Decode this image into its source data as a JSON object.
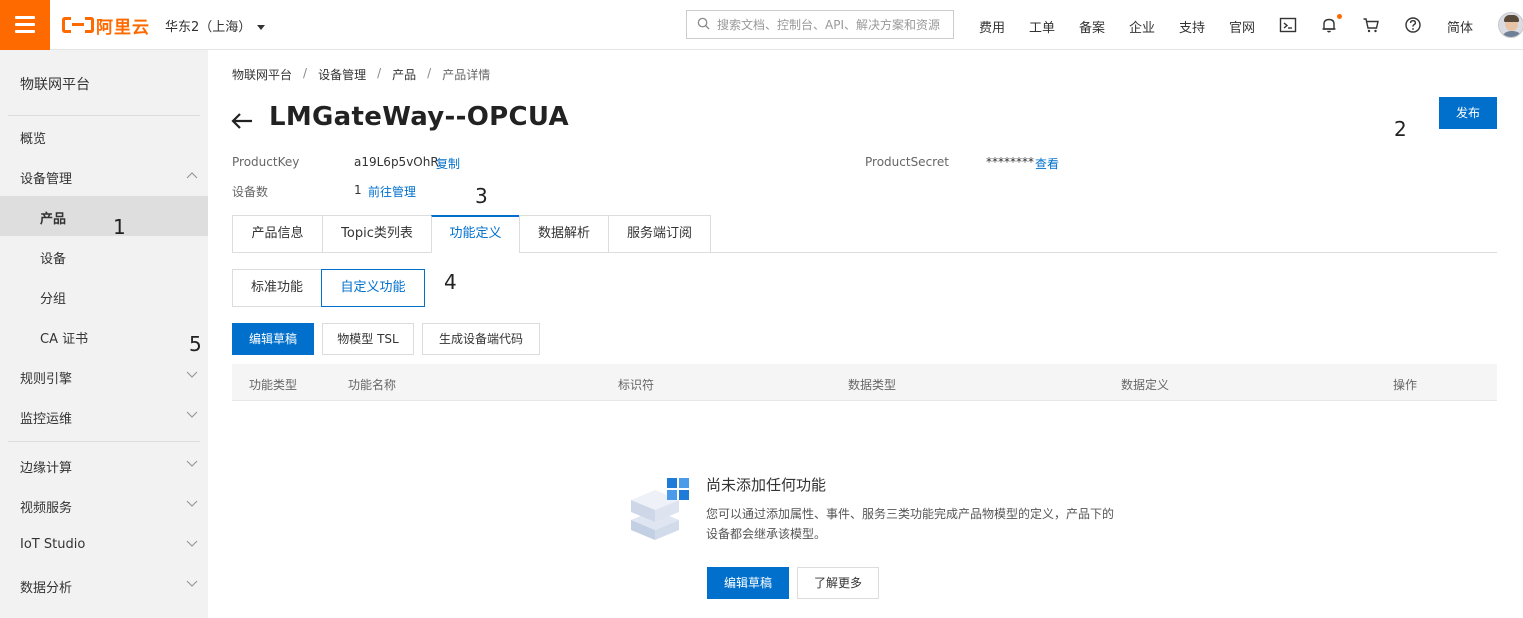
{
  "topbar": {
    "brand": "阿里云",
    "region": "华东2（上海）",
    "search_placeholder": "搜索文档、控制台、API、解决方案和资源",
    "nav": [
      "费用",
      "工单",
      "备案",
      "企业",
      "支持",
      "官网"
    ],
    "lang": "简体",
    "accent_color": "#ff6a00"
  },
  "sidebar": {
    "title": "物联网平台",
    "items": [
      {
        "label": "概览"
      },
      {
        "label": "设备管理"
      },
      {
        "label": "产品"
      },
      {
        "label": "设备"
      },
      {
        "label": "分组"
      },
      {
        "label": "CA 证书"
      },
      {
        "label": "规则引擎"
      },
      {
        "label": "监控运维"
      },
      {
        "label": "边缘计算"
      },
      {
        "label": "视频服务"
      },
      {
        "label": "IoT Studio"
      },
      {
        "label": "数据分析"
      }
    ]
  },
  "annotations": [
    "1",
    "2",
    "3",
    "4",
    "5"
  ],
  "breadcrumb": [
    "物联网平台",
    "设备管理",
    "产品",
    "产品详情"
  ],
  "page": {
    "title": "LMGateWay--OPCUA",
    "publish_button": "发布",
    "product_key_label": "ProductKey",
    "product_key_value": "a19L6p5vOhR",
    "copy_link": "复制",
    "product_secret_label": "ProductSecret",
    "product_secret_value": "********",
    "view_link": "查看",
    "device_count_label": "设备数",
    "device_count_value": "1",
    "manage_link": "前往管理"
  },
  "tabs": [
    "产品信息",
    "Topic类列表",
    "功能定义",
    "数据解析",
    "服务端订阅"
  ],
  "active_tab": "功能定义",
  "segments": [
    "标准功能",
    "自定义功能"
  ],
  "active_segment": "自定义功能",
  "toolbar": {
    "edit_draft": "编辑草稿",
    "tsl": "物模型 TSL",
    "gen_code": "生成设备端代码"
  },
  "table": {
    "columns": [
      "功能类型",
      "功能名称",
      "标识符",
      "数据类型",
      "数据定义",
      "操作"
    ]
  },
  "empty": {
    "title": "尚未添加任何功能",
    "desc": "您可以通过添加属性、事件、服务三类功能完成产品物模型的定义，产品下的设备都会继承该模型。",
    "edit_button": "编辑草稿",
    "learn_more": "了解更多"
  },
  "colors": {
    "primary": "#0070cc",
    "accent": "#ff6a00"
  }
}
